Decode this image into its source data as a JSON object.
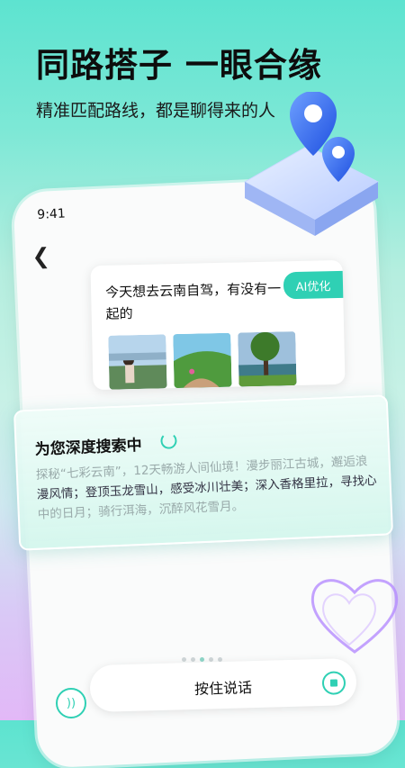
{
  "hero": {
    "title": "同路搭子  一眼合缘",
    "subtitle": "精准匹配路线，都是聊得来的人"
  },
  "phone": {
    "time": "9:41",
    "back_icon": "chevron-left-icon"
  },
  "query": {
    "text": "今天想去云南自驾，有没有一起的",
    "ai_button": "AI优化",
    "photos": [
      "person-in-mountains",
      "green-hills-trail",
      "tree-by-lake"
    ]
  },
  "search": {
    "title": "为您深度搜索中",
    "faded_text": "探秘“七彩云南”，12天畅游人间仙境！漫步丽江古城，邂逅浪",
    "dark_text": "漫风情；登顶玉龙雪山，感受冰川壮美；深入香格里拉，寻找心",
    "faded_text2": "中的日月；骑行洱海，沉醉风花雪月。"
  },
  "bottom": {
    "hold_to_talk": "按住说话"
  },
  "colors": {
    "accent": "#2fd0b4"
  }
}
